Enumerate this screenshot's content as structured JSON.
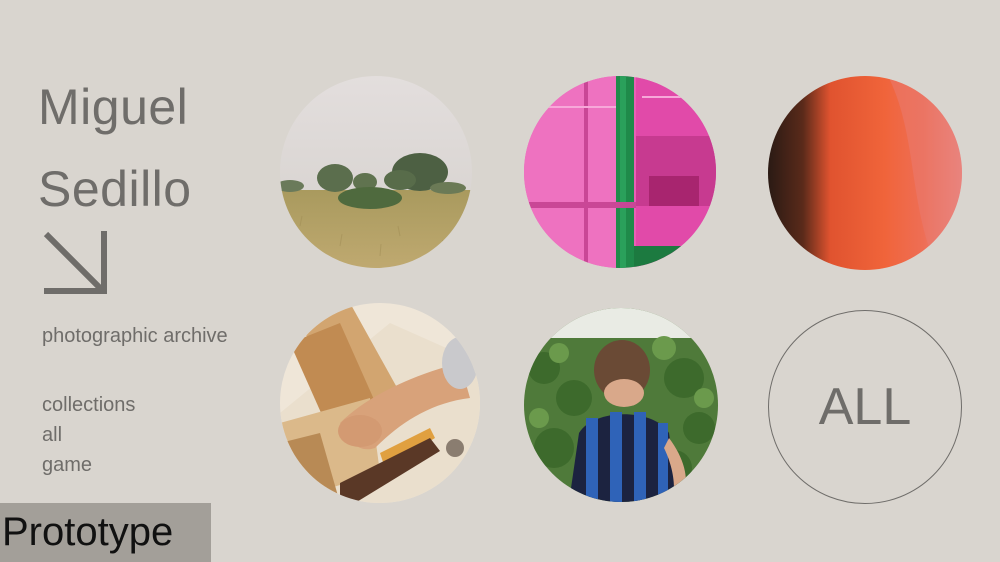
{
  "header": {
    "first_name": "Miguel",
    "last_name": "Sedillo"
  },
  "subtitle": "photographic archive",
  "nav": {
    "items": [
      {
        "label": "collections"
      },
      {
        "label": "all"
      },
      {
        "label": "game"
      }
    ]
  },
  "badge": {
    "label": "Prototype"
  },
  "gallery": {
    "all_label": "ALL",
    "photos": [
      {
        "subject": "foggy field with trees"
      },
      {
        "subject": "pink greenhouse with green door"
      },
      {
        "subject": "red film light leak"
      },
      {
        "subject": "hand with wood plane"
      },
      {
        "subject": "boy in striped shirt by hedge"
      }
    ]
  },
  "colors": {
    "background": "#d9d5cf",
    "text": "#6f6d6a",
    "badge_bg": "#a39f99"
  }
}
